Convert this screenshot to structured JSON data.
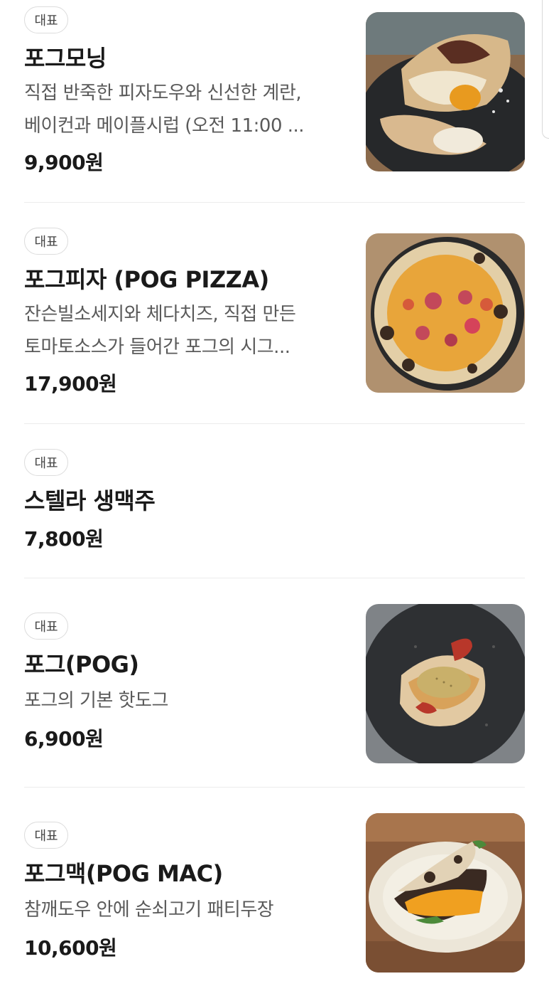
{
  "menu": {
    "items": [
      {
        "badge": "대표",
        "name": "포그모닝",
        "desc1": "직접 반죽한 피자도우와 신선한 계란,",
        "desc2": "베이컨과 메이플시럽 (오전 11:00 ...",
        "price": "9,900원",
        "image_icon": "breakfast-pizza-photo"
      },
      {
        "badge": "대표",
        "name": "포그피자 (POG PIZZA)",
        "desc1": "잔슨빌소세지와 체다치즈, 직접 만든",
        "desc2": "토마토소스가 들어간 포그의 시그...",
        "price": "17,900원",
        "image_icon": "pizza-photo"
      },
      {
        "badge": "대표",
        "name": "스텔라 생맥주",
        "price": "7,800원"
      },
      {
        "badge": "대표",
        "name": "포그(POG)",
        "desc1": "포그의 기본 핫도그",
        "price": "6,900원",
        "image_icon": "hotdog-photo"
      },
      {
        "badge": "대표",
        "name": "포그맥(POG MAC)",
        "desc1": "참깨도우 안에 순쇠고기 패티두장",
        "price": "10,600원",
        "image_icon": "burger-photo"
      }
    ]
  },
  "colors": {
    "text": "#1a1a1a",
    "description": "#5a5a5a",
    "divider": "#ececec",
    "badge_border": "#dcdcdc"
  }
}
